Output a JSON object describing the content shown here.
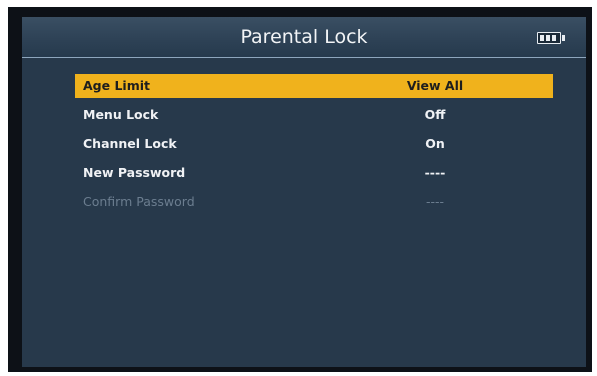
{
  "header": {
    "title": "Parental Lock",
    "battery_icon": "battery-icon"
  },
  "menu": {
    "items": [
      {
        "label": "Age Limit",
        "value": "View All",
        "state": "selected"
      },
      {
        "label": "Menu Lock",
        "value": "Off",
        "state": "normal"
      },
      {
        "label": "Channel Lock",
        "value": "On",
        "state": "normal"
      },
      {
        "label": "New Password",
        "value": "----",
        "state": "normal"
      },
      {
        "label": "Confirm Password",
        "value": "----",
        "state": "disabled"
      }
    ]
  },
  "colors": {
    "highlight": "#f0b21c",
    "panel": "#27394b",
    "disabled_text": "#6b7d8f"
  }
}
